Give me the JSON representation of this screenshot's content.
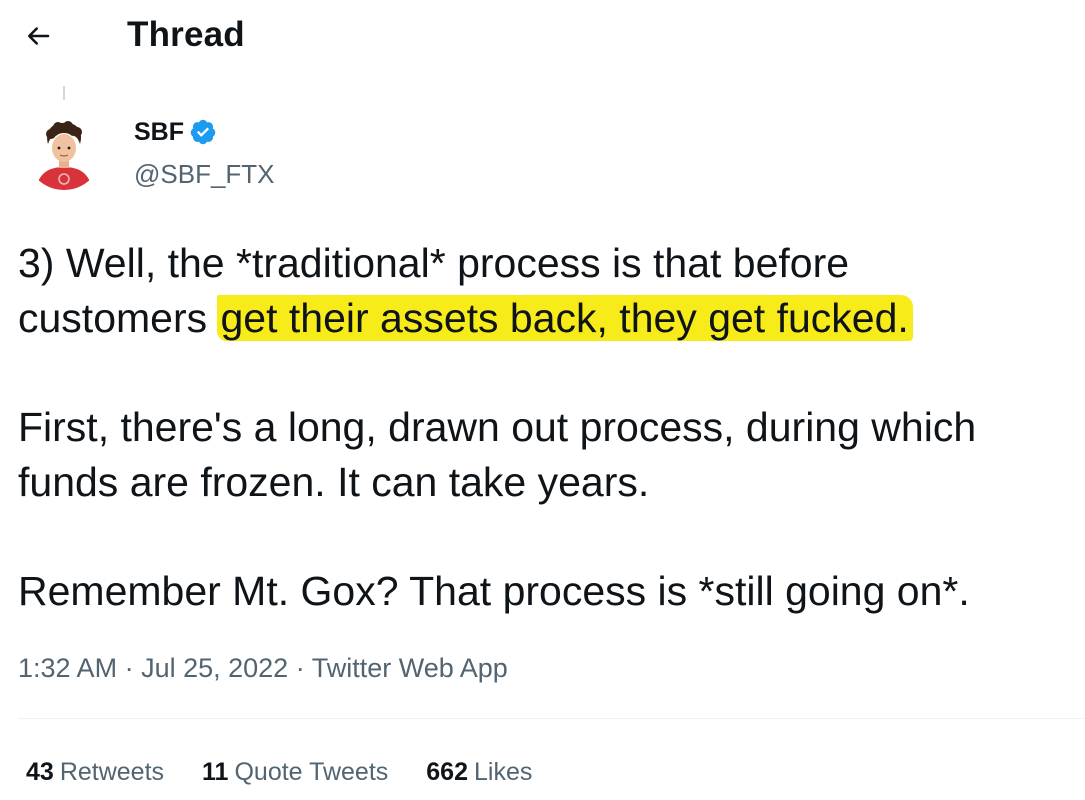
{
  "header": {
    "title": "Thread",
    "back_icon": "arrow-left-icon"
  },
  "author": {
    "name": "SBF",
    "handle": "@SBF_FTX",
    "verified_icon": "verified-badge-icon",
    "verified_color": "#1d9bf0"
  },
  "tweet": {
    "paragraphs": [
      {
        "line1": "3) Well, the *traditional* process is that before",
        "line2_plain": "customers ",
        "line2_highlight": "get their assets back, they get fucked."
      },
      {
        "line1": "First, there's a long, drawn out process, during which",
        "line2": "funds are frozen.  It can take years."
      },
      {
        "line1": "Remember Mt. Gox?  That process is *still going on*."
      }
    ],
    "highlight_color": "#f7ec1a"
  },
  "meta": {
    "time": "1:32 AM",
    "sep": " · ",
    "date": "Jul 25, 2022",
    "source": "Twitter Web App"
  },
  "stats": {
    "retweets_count": "43",
    "retweets_label": "Retweets",
    "quotes_count": "11",
    "quotes_label": "Quote Tweets",
    "likes_count": "662",
    "likes_label": "Likes"
  }
}
